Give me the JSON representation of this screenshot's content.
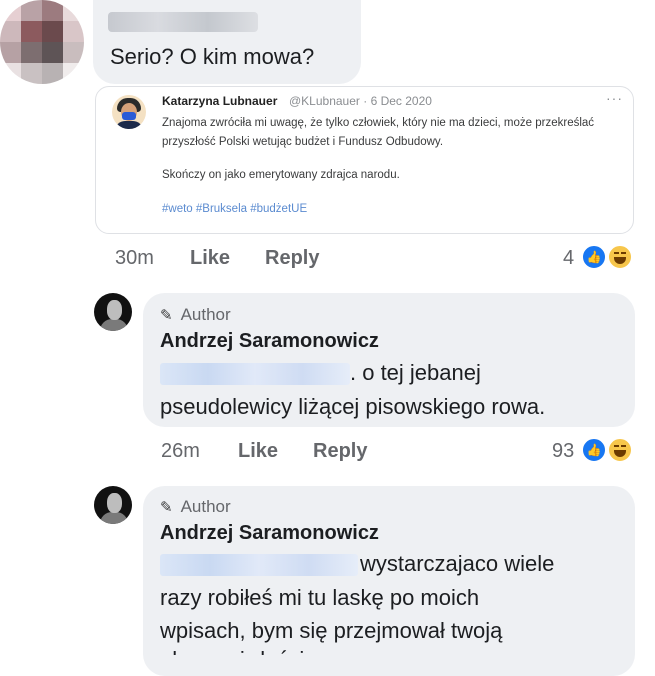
{
  "comment1": {
    "text": "Serio? O kim mowa?"
  },
  "tweet": {
    "author": "Katarzyna Lubnauer",
    "handle_date": "@KLubnauer · 6 Dec 2020",
    "more": "···",
    "body": "Znajoma zwróciła mi uwagę, że tylko człowiek, który nie ma dzieci, może przekreślać przyszłość Polski wetując budżet i Fundusz Odbudowy.",
    "body2": "Skończy on jako emerytowany zdrajca narodu.",
    "hashtags": "#weto #Bruksela #budżetUE"
  },
  "comment1_actions": {
    "time": "30m",
    "like": "Like",
    "reply": "Reply",
    "reaction_count": "4"
  },
  "comment2": {
    "badge": "Author",
    "name": "Andrzej Saramonowicz",
    "text_after_mention": ". o tej jebanej",
    "line2": "pseudolewicy liżącej pisowskiego rowa."
  },
  "comment2_actions": {
    "time": "26m",
    "like": "Like",
    "reply": "Reply",
    "reaction_count": "93"
  },
  "comment3": {
    "badge": "Author",
    "name": "Andrzej Saramonowicz",
    "text_after_mention": "wystarczajaco wiele",
    "line2": "razy robiłeś mi tu laskę po moich",
    "line3": "wpisach, bym się przejmował twoją",
    "line4": "obscen żałością"
  },
  "colors": {
    "bubble": "#eef0f3",
    "like_blue": "#1877f2",
    "haha_yellow": "#f7c64b",
    "hashtag": "#5b8bd0",
    "meta_gray": "#65676b"
  },
  "icons": [
    "pencil-icon",
    "like-reaction-icon",
    "haha-reaction-icon",
    "more-icon"
  ]
}
